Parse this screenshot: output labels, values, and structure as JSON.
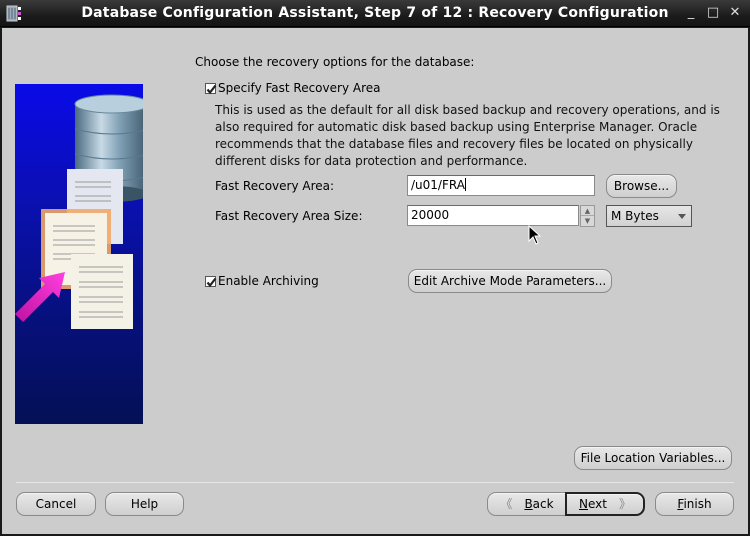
{
  "window": {
    "title": "Database Configuration Assistant, Step 7 of 12 : Recovery Configuration",
    "minimize_glyph": "_",
    "maximize_glyph": "□",
    "close_glyph": "✕"
  },
  "main": {
    "intro": "Choose the recovery options for the database:",
    "fra_checkbox": {
      "label": "Specify Fast Recovery Area",
      "checked": true
    },
    "description": "This is used as the default for all disk based backup and recovery operations, and is also required for automatic disk based backup using Enterprise Manager. Oracle recommends that the database files and recovery files be located on physically different disks for data protection and performance.",
    "fra_location": {
      "label": "Fast Recovery Area:",
      "value": "/u01/FRA"
    },
    "browse_button": "Browse...",
    "fra_size": {
      "label": "Fast Recovery Area Size:",
      "value": "20000"
    },
    "size_unit": {
      "selected": "M Bytes"
    },
    "archiving_checkbox": {
      "label": "Enable Archiving",
      "checked": true
    },
    "edit_archive_button": "Edit Archive Mode Parameters...",
    "file_location_button": "File Location Variables..."
  },
  "footer": {
    "cancel": "Cancel",
    "help": "Help",
    "back": {
      "mnemonic": "B",
      "rest": "ack"
    },
    "next": {
      "mnemonic": "N",
      "rest": "ext"
    },
    "finish": {
      "mnemonic": "F",
      "rest": "inish"
    }
  },
  "colors": {
    "dialog_bg": "#cccccc",
    "titlebar_bg": "#1c1c1c",
    "illustration_blue": "#0a0ae8",
    "arrow_magenta": "#e020c0"
  }
}
